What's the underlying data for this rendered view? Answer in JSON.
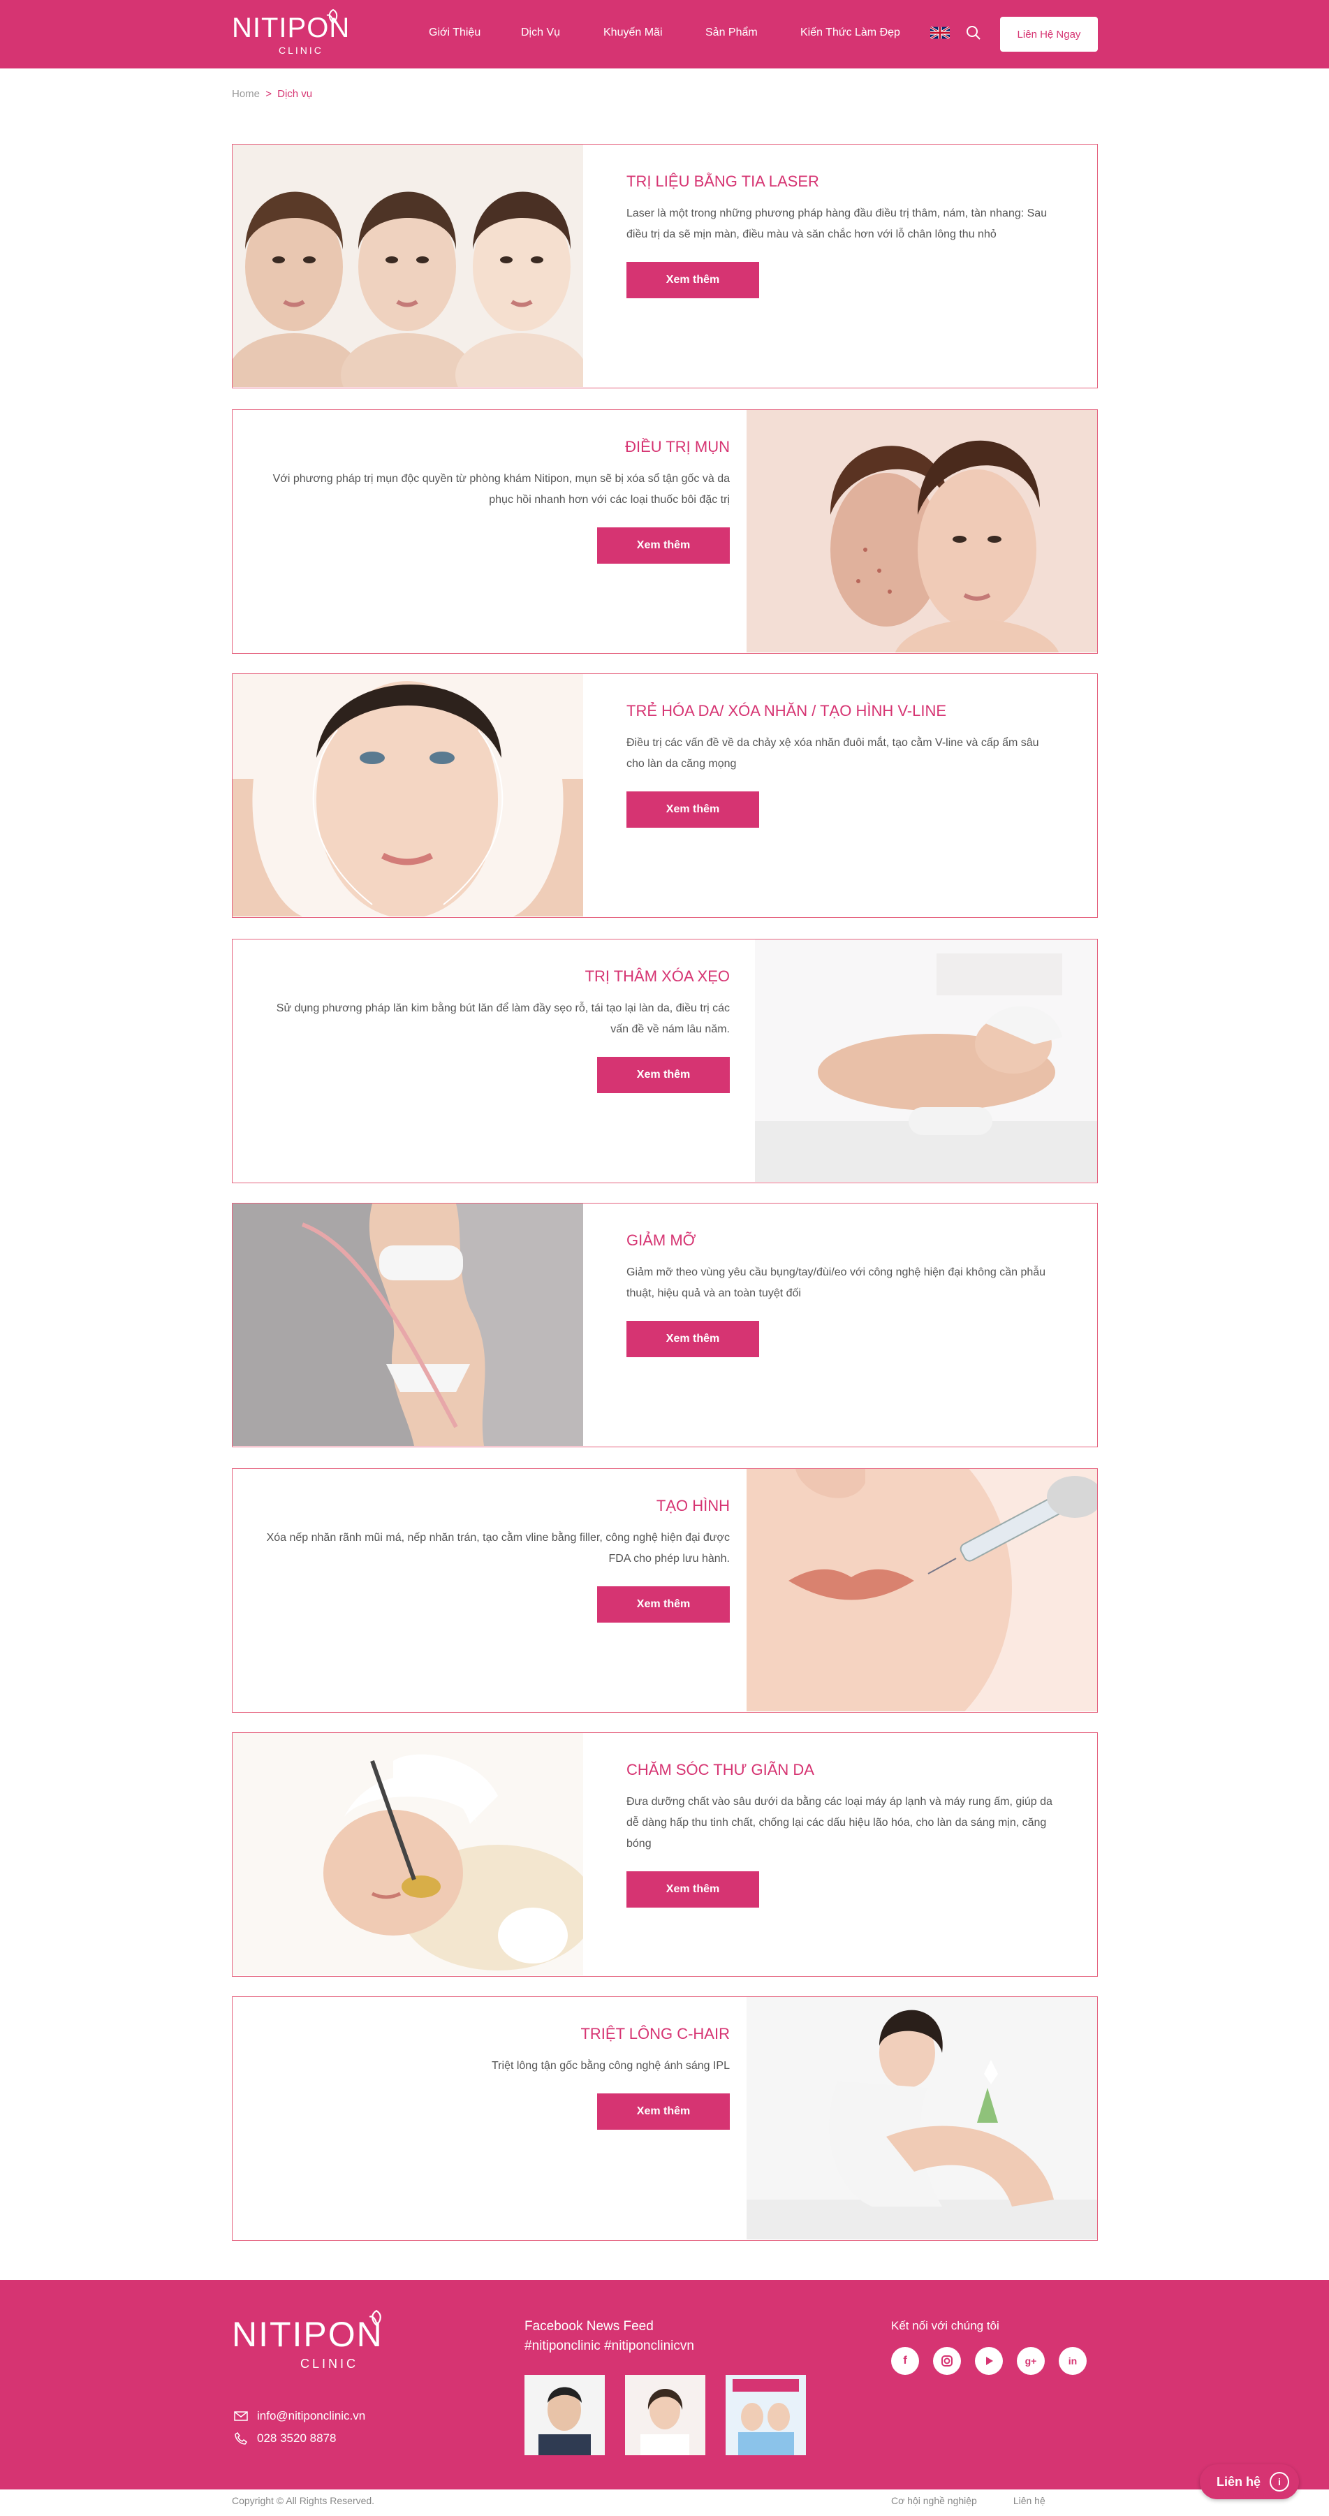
{
  "header": {
    "brand": "NITIPON",
    "brand_sub": "CLINIC",
    "nav": [
      "Giới Thiệu",
      "Dịch Vụ",
      "Khuyến Mãi",
      "Sản Phẩm",
      "Kiến Thức Làm Đẹp"
    ],
    "language_flag": "uk-flag-icon",
    "search_icon": "search-icon",
    "cta_label": "Liên Hệ Ngay"
  },
  "breadcrumb": {
    "home": "Home",
    "separator": ">",
    "current": "Dịch vụ"
  },
  "services": [
    {
      "title": "TRỊ LIỆU BẰNG TIA LASER",
      "desc": "Laser là một trong những phương pháp hàng đầu điều trị thâm, nám, tàn nhang: Sau điều trị da sẽ mịn màn, điều màu và săn chắc hơn với lỗ chân lông thu nhỏ",
      "button": "Xem thêm"
    },
    {
      "title": "ĐIỀU TRỊ MỤN",
      "desc": "Với phương pháp trị mụn độc quyền từ phòng khám Nitipon, mụn sẽ bị xóa sổ tận gốc và da phục hồi nhanh hơn với các loại thuốc bôi đặc trị",
      "button": "Xem thêm"
    },
    {
      "title": "TRẺ HÓA DA/ XÓA NHĂN / TẠO HÌNH V-LINE",
      "desc": "Điều trị các vấn đề về da chảy xệ xóa nhăn đuôi mắt, tạo cằm V-line và cấp ẩm sâu cho làn da căng mọng",
      "button": "Xem thêm"
    },
    {
      "title": "TRỊ THÂM XÓA XẸO",
      "desc": "Sử dụng phương pháp lăn kim bằng bút lăn để làm đầy sẹo rỗ, tái tạo lại làn da, điều trị các vấn đề về nám lâu năm.",
      "button": "Xem thêm"
    },
    {
      "title": "GIẢM MỠ",
      "desc": "Giảm mỡ theo vùng yêu cầu bụng/tay/đùi/eo với công nghệ hiện đại không cần phẫu thuật, hiệu quả và an toàn tuyệt đối",
      "button": "Xem thêm"
    },
    {
      "title": "TẠO HÌNH",
      "desc": "Xóa nếp nhăn rãnh mũi má, nếp nhăn trán, tạo cằm vline bằng filler, công nghệ hiện đại được FDA cho phép lưu hành.",
      "button": "Xem thêm"
    },
    {
      "title": "CHĂM SÓC THƯ GIÃN DA",
      "desc": "Đưa dưỡng chất vào sâu dưới da bằng các loại máy áp lạnh và máy rung ấm, giúp da dễ dàng hấp thu tinh chất, chống lại các dấu hiệu lão hóa, cho làn da sáng mịn, căng bóng",
      "button": "Xem thêm"
    },
    {
      "title": "TRIỆT LÔNG C-HAIR",
      "desc": "Triệt lông tận gốc bằng công nghệ ánh sáng IPL",
      "button": "Xem thêm"
    }
  ],
  "footer": {
    "brand": "NITIPON",
    "brand_sub": "CLINIC",
    "email": "info@nitiponclinic.vn",
    "phone": "028 3520 8878",
    "fb_title": "Facebook News Feed",
    "fb_tags": "#nitiponclinic #nitiponclinicvn",
    "social_title": "Kết nối với chúng tôi",
    "social_icons": [
      "facebook-icon",
      "instagram-icon",
      "youtube-icon",
      "google-plus-icon",
      "linkedin-icon"
    ]
  },
  "bottom": {
    "copyright": "Copyright © All Rights Reserved.",
    "links": [
      "Cơ hội nghề nghiệp",
      "Liên hệ"
    ]
  },
  "floating_contact": "Liên hệ",
  "colors": {
    "brand": "#d63472",
    "border": "#e5637f"
  }
}
